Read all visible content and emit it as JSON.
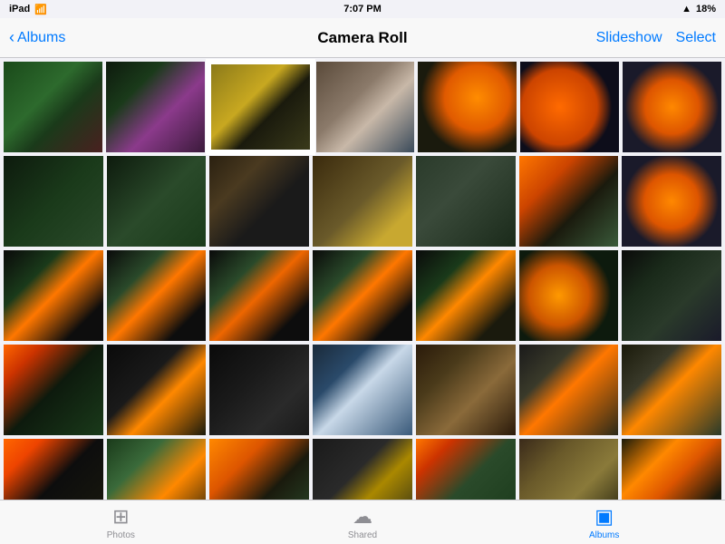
{
  "statusBar": {
    "carrier": "iPad",
    "wifi": "wifi",
    "time": "7:07 PM",
    "signal": "▲",
    "battery": "18%"
  },
  "navBar": {
    "backLabel": "Albums",
    "title": "Camera Roll",
    "slideshowLabel": "Slideshow",
    "selectLabel": "Select"
  },
  "tabs": [
    {
      "id": "photos",
      "label": "Photos",
      "icon": "⬜",
      "active": false
    },
    {
      "id": "shared",
      "label": "Shared",
      "icon": "☁",
      "active": false
    },
    {
      "id": "albums",
      "label": "Albums",
      "icon": "⬛",
      "active": true
    }
  ],
  "photos": {
    "rows": [
      [
        {
          "id": 1,
          "cls": "thumb-1"
        },
        {
          "id": 2,
          "cls": "thumb-2"
        },
        {
          "id": 3,
          "cls": "thumb-3",
          "selected": true
        },
        {
          "id": 4,
          "cls": "thumb-4"
        },
        {
          "id": 5,
          "cls": "thumb-5"
        },
        {
          "id": 6,
          "cls": "thumb-6"
        },
        {
          "id": 7,
          "cls": "thumb-7"
        }
      ],
      [
        {
          "id": 8,
          "cls": "thumb-8"
        },
        {
          "id": 9,
          "cls": "thumb-9"
        },
        {
          "id": 10,
          "cls": "thumb-10"
        },
        {
          "id": 11,
          "cls": "thumb-11"
        },
        {
          "id": 12,
          "cls": "thumb-12"
        },
        {
          "id": 13,
          "cls": "thumb-13"
        },
        {
          "id": 14,
          "cls": "thumb-7"
        }
      ],
      [
        {
          "id": 15,
          "cls": "thumb-14"
        },
        {
          "id": 16,
          "cls": "thumb-15"
        },
        {
          "id": 17,
          "cls": "thumb-16"
        },
        {
          "id": 18,
          "cls": "thumb-17"
        },
        {
          "id": 19,
          "cls": "thumb-18"
        },
        {
          "id": 20,
          "cls": "thumb-19"
        },
        {
          "id": 21,
          "cls": "thumb-20"
        }
      ],
      [
        {
          "id": 22,
          "cls": "thumb-21"
        },
        {
          "id": 23,
          "cls": "thumb-22"
        },
        {
          "id": 24,
          "cls": "thumb-23"
        },
        {
          "id": 25,
          "cls": "thumb-24"
        },
        {
          "id": 26,
          "cls": "thumb-25"
        },
        {
          "id": 27,
          "cls": "thumb-26"
        },
        {
          "id": 28,
          "cls": "thumb-27"
        }
      ],
      [
        {
          "id": 29,
          "cls": "thumb-28"
        },
        {
          "id": 30,
          "cls": "thumb-29"
        },
        {
          "id": 31,
          "cls": "thumb-30"
        },
        {
          "id": 32,
          "cls": "thumb-31"
        },
        {
          "id": 33,
          "cls": "thumb-32"
        },
        {
          "id": 34,
          "cls": "thumb-33"
        },
        {
          "id": 35,
          "cls": "thumb-34"
        }
      ]
    ]
  }
}
